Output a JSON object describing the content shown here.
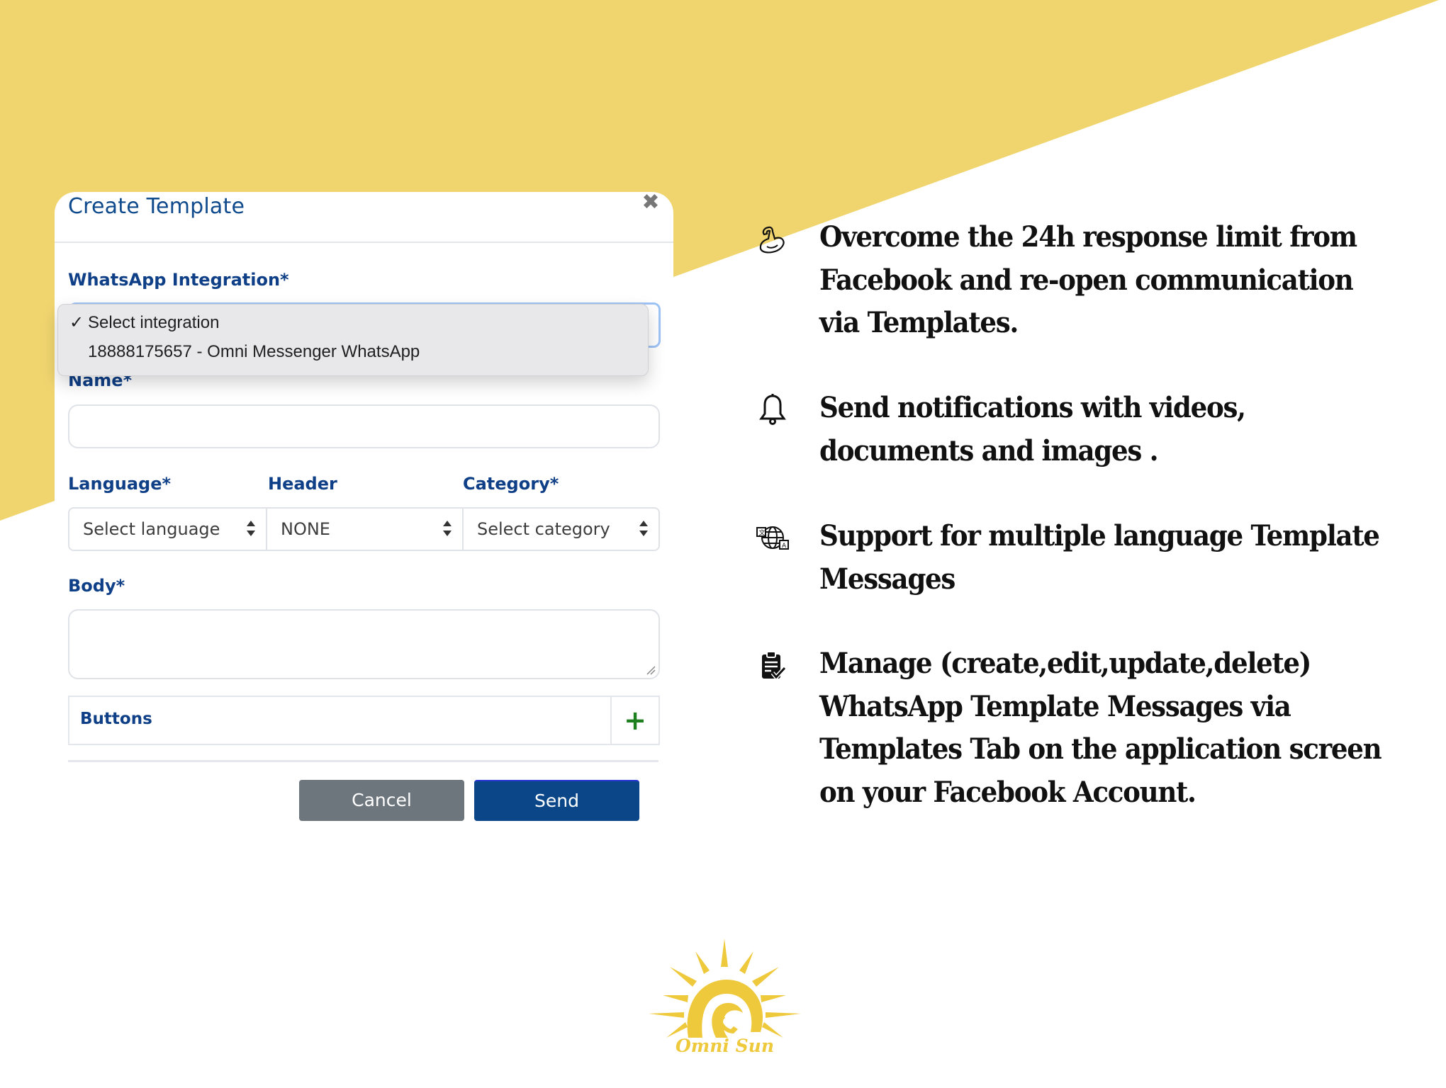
{
  "colors": {
    "background_yellow": "#f0d56f",
    "brand_blue": "#0f3f86",
    "send_blue": "#0b4788",
    "cancel_gray": "#6d757d",
    "add_green": "#1e7f1e",
    "logo_gold": "#efc93c"
  },
  "modal": {
    "title": "Create Template",
    "close_icon": "close-icon",
    "integration": {
      "label": "WhatsApp Integration*",
      "selected": "Select integration",
      "options": [
        {
          "label": "Select integration",
          "checked": true
        },
        {
          "label": "18888175657 - Omni Messenger WhatsApp",
          "checked": false
        }
      ]
    },
    "name": {
      "label": "Name*",
      "value": ""
    },
    "language": {
      "label": "Language*",
      "value": "Select language"
    },
    "header": {
      "label": "Header",
      "value": "NONE"
    },
    "category": {
      "label": "Category*",
      "value": "Select category"
    },
    "body": {
      "label": "Body*",
      "value": ""
    },
    "buttons": {
      "label": "Buttons",
      "add_icon": "plus-icon"
    },
    "cancel_label": "Cancel",
    "send_label": "Send"
  },
  "features": [
    {
      "icon": "flexed-bicep-icon",
      "lines": [
        "Overcome the 24h response limit from",
        "Facebook and re-open communication",
        "via Templates."
      ]
    },
    {
      "icon": "bell-icon",
      "lines": [
        "Send notifications with videos,",
        "documents and  images ."
      ]
    },
    {
      "icon": "globe-translate-icon",
      "lines": [
        "Support for multiple language Template",
        "Messages"
      ]
    },
    {
      "icon": "clipboard-check-icon",
      "lines": [
        "Manage (create,edit,update,delete)",
        "WhatsApp Template Messages via",
        "Templates Tab on the application screen",
        "on your Facebook Account."
      ]
    }
  ],
  "logo": {
    "text": "Omni Sun",
    "icon": "sun-phone-logo-icon"
  }
}
